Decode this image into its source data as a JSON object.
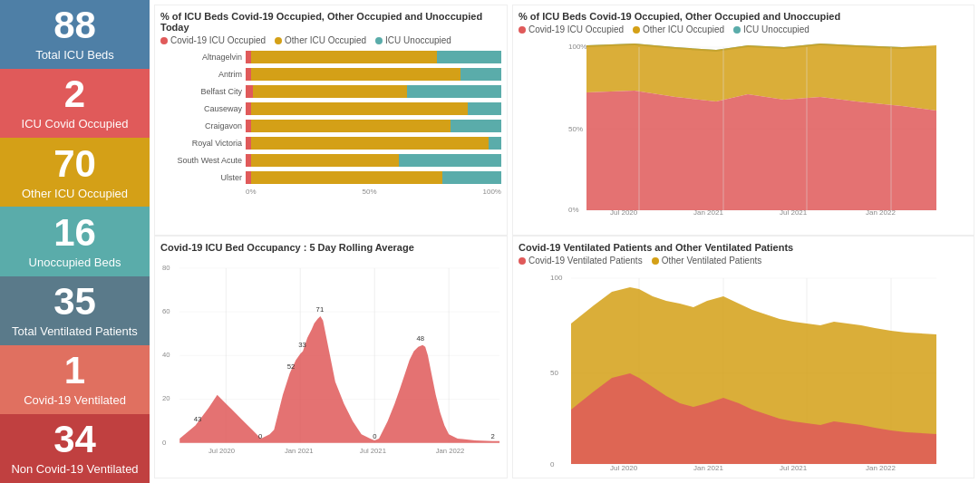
{
  "sidebar": {
    "cards": [
      {
        "id": "total-icu-beds",
        "number": "88",
        "label": "Total ICU Beds",
        "colorClass": "card-blue"
      },
      {
        "id": "icu-covid-occupied",
        "number": "2",
        "label": "ICU Covid Occupied",
        "colorClass": "card-red"
      },
      {
        "id": "other-icu-occupied",
        "number": "70",
        "label": "Other ICU Occupied",
        "colorClass": "card-gold"
      },
      {
        "id": "unoccupied-beds",
        "number": "16",
        "label": "Unoccupied Beds",
        "colorClass": "card-teal"
      },
      {
        "id": "total-ventilated",
        "number": "35",
        "label": "Total Ventilated Patients",
        "colorClass": "card-darkgray"
      },
      {
        "id": "covid-ventilated",
        "number": "1",
        "label": "Covid-19 Ventilated",
        "colorClass": "card-salmon"
      },
      {
        "id": "non-covid-ventilated",
        "number": "34",
        "label": "Non Covid-19 Ventilated",
        "colorClass": "card-darkred"
      }
    ]
  },
  "barChart": {
    "title": "% of ICU Beds Covid-19 Occupied, Other Occupied and Unoccupied Today",
    "legend": [
      {
        "label": "Covid-19 ICU Occupied",
        "color": "#e05a5a"
      },
      {
        "label": "Other ICU Occupied",
        "color": "#d4a017"
      },
      {
        "label": "ICU Unoccupied",
        "color": "#5aacaa"
      }
    ],
    "hospitals": [
      {
        "name": "Altnagelvin",
        "covid": 2,
        "other": 73,
        "unoccupied": 25
      },
      {
        "name": "Antrim",
        "covid": 2,
        "other": 82,
        "unoccupied": 16
      },
      {
        "name": "Belfast City",
        "covid": 3,
        "other": 60,
        "unoccupied": 37
      },
      {
        "name": "Causeway",
        "covid": 2,
        "other": 85,
        "unoccupied": 13
      },
      {
        "name": "Craigavon",
        "covid": 2,
        "other": 78,
        "unoccupied": 20
      },
      {
        "name": "Royal Victoria",
        "covid": 2,
        "other": 93,
        "unoccupied": 5
      },
      {
        "name": "South West Acute",
        "covid": 2,
        "other": 58,
        "unoccupied": 40
      },
      {
        "name": "Ulster",
        "covid": 2,
        "other": 75,
        "unoccupied": 23
      }
    ],
    "axisLabels": [
      "0%",
      "50%",
      "100%"
    ]
  },
  "areaChartTop": {
    "title": "% of ICU Beds Covid-19 Occupied, Other Occupied and Unoccupied",
    "legend": [
      {
        "label": "Covid-19 ICU Occupied",
        "color": "#e05a5a"
      },
      {
        "label": "Other ICU Occupied",
        "color": "#d4a017"
      },
      {
        "label": "ICU Unoccupied",
        "color": "#5aacaa"
      }
    ],
    "xLabels": [
      "Jul 2020",
      "Jan 2021",
      "Jul 2021",
      "Jan 2022"
    ],
    "yLabels": [
      "0%",
      "50%",
      "100%"
    ]
  },
  "lineChartBottom": {
    "title": "Covid-19 ICU Bed Occupancy : 5 Day Rolling Average",
    "xLabels": [
      "Jul 2020",
      "Jan 2021",
      "Jul 2021",
      "Jan 2022"
    ],
    "yLabels": [
      "0",
      "20",
      "40",
      "60",
      "80"
    ],
    "annotations": [
      "43",
      "0",
      "52",
      "33",
      "71",
      "48",
      "0",
      "2"
    ]
  },
  "areaChartBottomRight": {
    "title": "Covid-19 Ventilated Patients and Other Ventilated Patients",
    "legend": [
      {
        "label": "Covid-19 Ventilated Patients",
        "color": "#e05a5a"
      },
      {
        "label": "Other Ventilated Patients",
        "color": "#d4a017"
      }
    ],
    "xLabels": [
      "Jul 2020",
      "Jan 2021",
      "Jul 2021",
      "Jan 2022"
    ],
    "yLabels": [
      "0",
      "50",
      "100"
    ]
  }
}
